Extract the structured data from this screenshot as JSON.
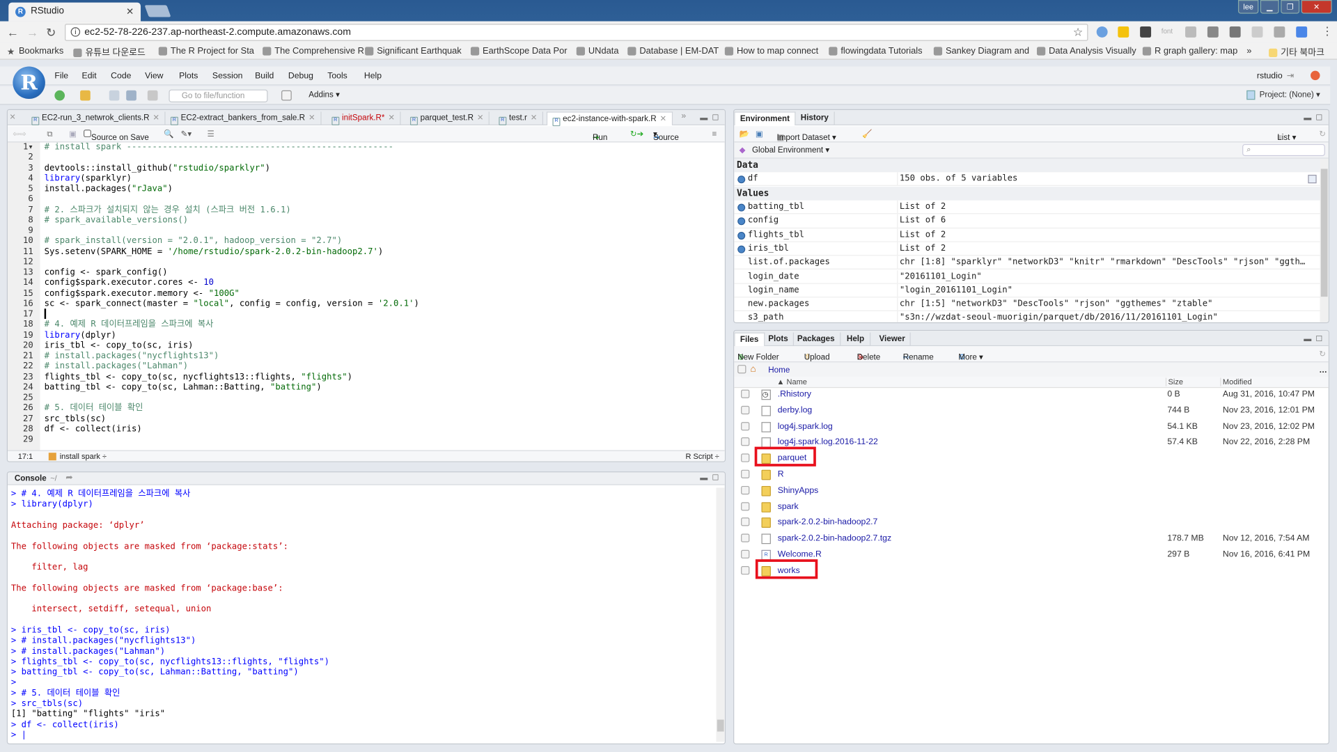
{
  "browser": {
    "tab_title": "RStudio",
    "url": "ec2-52-78-226-237.ap-northeast-2.compute.amazonaws.com",
    "user_badge": "lee",
    "bookmarks": [
      "Bookmarks",
      "유튜브 다운로드",
      "The R Project for Sta",
      "The Comprehensive R",
      "Significant Earthquak",
      "EarthScope Data Por",
      "UNdata",
      "Database | EM-DAT",
      "How to map connect",
      "flowingdata Tutorials",
      "Sankey Diagram and",
      "Data Analysis Visually",
      "R graph gallery: map"
    ],
    "other_bookmarks": "기타 북마크",
    "more_bookmarks": "»",
    "extension_font_label": "font"
  },
  "rstudio": {
    "menu": [
      "File",
      "Edit",
      "Code",
      "View",
      "Plots",
      "Session",
      "Build",
      "Debug",
      "Tools",
      "Help"
    ],
    "goto_placeholder": "Go to file/function",
    "addins": "Addins ▾",
    "user": "rstudio",
    "project": "Project: (None) ▾"
  },
  "editor": {
    "tabs": [
      {
        "label": "EC2-run_3_netwrok_clients.R",
        "modified": false
      },
      {
        "label": "EC2-extract_bankers_from_sale.R",
        "modified": false
      },
      {
        "label": "initSpark.R*",
        "modified": true
      },
      {
        "label": "parquet_test.R",
        "modified": false
      },
      {
        "label": "test.r",
        "modified": false
      },
      {
        "label": "ec2-instance-with-spark.R",
        "modified": false,
        "active": true
      }
    ],
    "source_on_save": "Source on Save",
    "run": "Run",
    "source": "Source",
    "lines": [
      [
        [
          "comment",
          "# install spark ----------------------------------------------------"
        ]
      ],
      [],
      [
        [
          "plain",
          "devtools::install_github("
        ],
        [
          "str",
          "\"rstudio/sparklyr\""
        ],
        [
          "plain",
          ")"
        ]
      ],
      [
        [
          "kw",
          "library"
        ],
        [
          "plain",
          "(sparklyr)"
        ]
      ],
      [
        [
          "plain",
          "install.packages("
        ],
        [
          "str",
          "\"rJava\""
        ],
        [
          "plain",
          ")"
        ]
      ],
      [],
      [
        [
          "comment",
          "# 2. 스파크가 설치되지 않는 경우 설치 (스파크 버전 1.6.1)"
        ]
      ],
      [
        [
          "comment",
          "# spark_available_versions()"
        ]
      ],
      [],
      [
        [
          "comment",
          "# spark_install(version = \"2.0.1\", hadoop_version = \"2.7\")"
        ]
      ],
      [
        [
          "plain",
          "Sys.setenv(SPARK_HOME = "
        ],
        [
          "str",
          "'/home/rstudio/spark-2.0.2-bin-hadoop2.7'"
        ],
        [
          "plain",
          ")"
        ]
      ],
      [],
      [
        [
          "plain",
          "config <- spark_config()"
        ]
      ],
      [
        [
          "plain",
          "config$spark.executor.cores <- "
        ],
        [
          "num",
          "10"
        ]
      ],
      [
        [
          "plain",
          "config$spark.executor.memory <- "
        ],
        [
          "str",
          "\"100G\""
        ]
      ],
      [
        [
          "plain",
          "sc <- spark_connect(master = "
        ],
        [
          "str",
          "\"local\""
        ],
        [
          "plain",
          ", config = config, version = "
        ],
        [
          "str",
          "'2.0.1'"
        ],
        [
          "plain",
          ")"
        ]
      ],
      [],
      [
        [
          "comment",
          "# 4. 예제 R 데이터프레임을 스파크에 복사"
        ]
      ],
      [
        [
          "kw",
          "library"
        ],
        [
          "plain",
          "(dplyr)"
        ]
      ],
      [
        [
          "plain",
          "iris_tbl <- copy_to(sc, iris)"
        ]
      ],
      [
        [
          "comment",
          "# install.packages(\"nycflights13\")"
        ]
      ],
      [
        [
          "comment",
          "# install.packages(\"Lahman\")"
        ]
      ],
      [
        [
          "plain",
          "flights_tbl <- copy_to(sc, nycflights13::flights, "
        ],
        [
          "str",
          "\"flights\""
        ],
        [
          "plain",
          ")"
        ]
      ],
      [
        [
          "plain",
          "batting_tbl <- copy_to(sc, Lahman::Batting, "
        ],
        [
          "str",
          "\"batting\""
        ],
        [
          "plain",
          ")"
        ]
      ],
      [],
      [
        [
          "comment",
          "# 5. 데이터 테이블 확인"
        ]
      ],
      [
        [
          "plain",
          "src_tbls(sc)"
        ]
      ],
      [
        [
          "plain",
          "df <- collect(iris)"
        ]
      ],
      []
    ],
    "cursor_pos": "17:1",
    "section": "install spark ÷",
    "file_type": "R Script ÷"
  },
  "console": {
    "title": "Console",
    "path": "~/",
    "lines": [
      [
        "in",
        "> # 4. 예제 R 데이터프레임을 스파크에 복사"
      ],
      [
        "in",
        "> library(dplyr)"
      ],
      [
        "blank",
        ""
      ],
      [
        "msg",
        "Attaching package: ‘dplyr’"
      ],
      [
        "blank",
        ""
      ],
      [
        "msg",
        "The following objects are masked from ‘package:stats’:"
      ],
      [
        "blank",
        ""
      ],
      [
        "msg",
        "    filter, lag"
      ],
      [
        "blank",
        ""
      ],
      [
        "msg",
        "The following objects are masked from ‘package:base’:"
      ],
      [
        "blank",
        ""
      ],
      [
        "msg",
        "    intersect, setdiff, setequal, union"
      ],
      [
        "blank",
        ""
      ],
      [
        "in",
        "> iris_tbl <- copy_to(sc, iris)"
      ],
      [
        "in",
        "> # install.packages(\"nycflights13\")"
      ],
      [
        "in",
        "> # install.packages(\"Lahman\")"
      ],
      [
        "in",
        "> flights_tbl <- copy_to(sc, nycflights13::flights, \"flights\")"
      ],
      [
        "in",
        "> batting_tbl <- copy_to(sc, Lahman::Batting, \"batting\")"
      ],
      [
        "in",
        ">"
      ],
      [
        "in",
        "> # 5. 데이터 테이블 확인"
      ],
      [
        "in",
        "> src_tbls(sc)"
      ],
      [
        "out",
        "[1] \"batting\" \"flights\" \"iris\""
      ],
      [
        "in",
        "> df <- collect(iris)"
      ],
      [
        "in",
        "> |"
      ]
    ]
  },
  "environment": {
    "tabs": [
      "Environment",
      "History"
    ],
    "import_dataset": "Import Dataset ▾",
    "view_mode": "List ▾",
    "scope": "Global Environment ▾",
    "sections": {
      "data": "Data",
      "values": "Values"
    },
    "data": [
      {
        "name": "df",
        "value": "150 obs. of 5 variables"
      }
    ],
    "values": [
      {
        "name": "batting_tbl",
        "value": "List of 2",
        "expandable": true
      },
      {
        "name": "config",
        "value": "List of 6",
        "expandable": true
      },
      {
        "name": "flights_tbl",
        "value": "List of 2",
        "expandable": true
      },
      {
        "name": "iris_tbl",
        "value": "List of 2",
        "expandable": true
      },
      {
        "name": "list.of.packages",
        "value": "chr [1:8] \"sparklyr\" \"networkD3\" \"knitr\" \"rmarkdown\" \"DescTools\" \"rjson\" \"ggth…",
        "expandable": false
      },
      {
        "name": "login_date",
        "value": "\"20161101_Login\"",
        "expandable": false
      },
      {
        "name": "login_name",
        "value": "\"login_20161101_Login\"",
        "expandable": false
      },
      {
        "name": "new.packages",
        "value": "chr [1:5] \"networkD3\" \"DescTools\" \"rjson\" \"ggthemes\" \"ztable\"",
        "expandable": false
      },
      {
        "name": "s3_path",
        "value": "\"s3n://wzdat-seoul-muorigin/parquet/db/2016/11/20161101_Login\"",
        "expandable": false
      }
    ]
  },
  "files": {
    "tabs": [
      "Files",
      "Plots",
      "Packages",
      "Help",
      "Viewer"
    ],
    "toolbar": {
      "new_folder": "New Folder",
      "upload": "Upload",
      "delete": "Delete",
      "rename": "Rename",
      "more": "More ▾"
    },
    "path": "Home",
    "columns": {
      "name": "▲ Name",
      "size": "Size",
      "modified": "Modified"
    },
    "rows": [
      {
        "name": ".Rhistory",
        "type": "history",
        "size": "0 B",
        "modified": "Aug 31, 2016, 10:47 PM"
      },
      {
        "name": "derby.log",
        "type": "file",
        "size": "744 B",
        "modified": "Nov 23, 2016, 12:01 PM"
      },
      {
        "name": "log4j.spark.log",
        "type": "file",
        "size": "54.1 KB",
        "modified": "Nov 23, 2016, 12:02 PM"
      },
      {
        "name": "log4j.spark.log.2016-11-22",
        "type": "file",
        "size": "57.4 KB",
        "modified": "Nov 22, 2016, 2:28 PM"
      },
      {
        "name": "parquet",
        "type": "folder",
        "size": "",
        "modified": "",
        "highlighted": true
      },
      {
        "name": "R",
        "type": "folder",
        "size": "",
        "modified": ""
      },
      {
        "name": "ShinyApps",
        "type": "folder",
        "size": "",
        "modified": ""
      },
      {
        "name": "spark",
        "type": "folder",
        "size": "",
        "modified": ""
      },
      {
        "name": "spark-2.0.2-bin-hadoop2.7",
        "type": "folder",
        "size": "",
        "modified": ""
      },
      {
        "name": "spark-2.0.2-bin-hadoop2.7.tgz",
        "type": "file",
        "size": "178.7 MB",
        "modified": "Nov 12, 2016, 7:54 AM"
      },
      {
        "name": "Welcome.R",
        "type": "rfile",
        "size": "297 B",
        "modified": "Nov 16, 2016, 6:41 PM"
      },
      {
        "name": "works",
        "type": "folder",
        "size": "",
        "modified": "",
        "highlighted": true
      }
    ],
    "highlight_color": "#e8101c"
  }
}
